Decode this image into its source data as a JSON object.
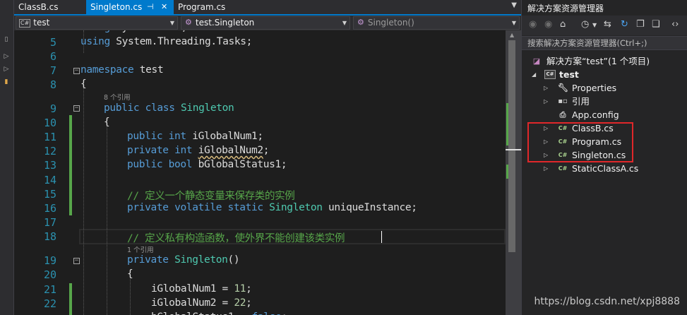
{
  "tabs": [
    {
      "label": "ClassB.cs",
      "active": false
    },
    {
      "label": "Singleton.cs",
      "active": true,
      "pin": "⊣",
      "close": "✕"
    },
    {
      "label": "Program.cs",
      "active": false
    }
  ],
  "navbar": {
    "project": "test",
    "project_icon": "C#",
    "class": "test.Singleton",
    "member": "Singleton()"
  },
  "editor": {
    "lines": [
      {
        "num": "",
        "text": "using System.Text;"
      },
      {
        "num": "5",
        "text": "using System.Threading.Tasks;"
      },
      {
        "num": "6",
        "text": ""
      },
      {
        "num": "7",
        "text": "namespace test"
      },
      {
        "num": "8",
        "text": "{"
      },
      {
        "num": "9",
        "text": "public class Singleton"
      },
      {
        "num": "10",
        "text": "{"
      },
      {
        "num": "11",
        "text": "public int iGlobalNum1;"
      },
      {
        "num": "12",
        "text": "private int iGlobalNum2;"
      },
      {
        "num": "13",
        "text": "public bool bGlobalStatus1;"
      },
      {
        "num": "14",
        "text": ""
      },
      {
        "num": "15",
        "text": "// 定义一个静态变量来保存类的实例"
      },
      {
        "num": "16",
        "text": "private volatile static Singleton uniqueInstance;"
      },
      {
        "num": "17",
        "text": ""
      },
      {
        "num": "18",
        "text": "// 定义私有构造函数，使外界不能创建该类实例"
      },
      {
        "num": "19",
        "text": "private Singleton()"
      },
      {
        "num": "20",
        "text": "{"
      },
      {
        "num": "21",
        "text": "iGlobalNum1 = 11;"
      },
      {
        "num": "22",
        "text": "iGlobalNum2 = 22;"
      }
    ],
    "codelens": [
      "8 个引用",
      "1 个引用"
    ]
  },
  "solution_explorer": {
    "title": "解决方案资源管理器",
    "search_placeholder": "搜索解决方案资源管理器(Ctrl+;)",
    "solution": "解决方案“test”(1 个项目)",
    "project": "test",
    "items": [
      "Properties",
      "引用",
      "App.config",
      "ClassB.cs",
      "Program.cs",
      "Singleton.cs",
      "StaticClassA.cs"
    ]
  },
  "watermark": "https://blog.csdn.net/xpj8888",
  "colors": {
    "accent": "#007acc",
    "keyword": "#569cd6",
    "type": "#4ec9b0",
    "comment": "#57a64a",
    "number": "#b5cea8",
    "line_number": "#2b91af",
    "highlight_box": "#e0272a"
  }
}
